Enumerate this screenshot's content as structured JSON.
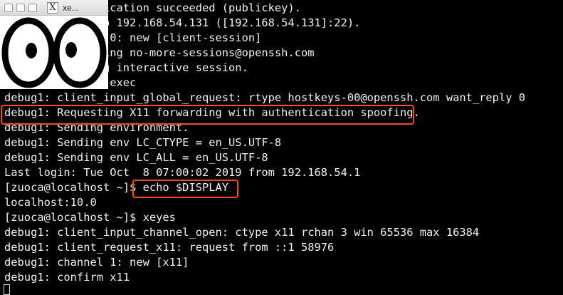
{
  "terminal": {
    "lines": [
      "debug1: Authentication succeeded (publickey).",
      "Authenticated to 192.168.54.131 ([192.168.54.131]:22).",
      "debug1: channel 0: new [client-session]",
      "debug1: Requesting no-more-sessions@openssh.com",
      "debug1: Entering interactive session.",
      "debug1: pledge: exec",
      "debug1: client_input_global_request: rtype hostkeys-00@openssh.com want_reply 0",
      "debug1: Requesting X11 forwarding with authentication spoofing.",
      "debug1: Sending environment.",
      "debug1: Sending env LC_CTYPE = en_US.UTF-8",
      "debug1: Sending env LC_ALL = en_US.UTF-8",
      "Last login: Tue Oct  8 07:00:02 2019 from 192.168.54.1",
      "[zuoca@localhost ~]$ echo $DISPLAY",
      "localhost:10.0",
      "[zuoca@localhost ~]$ xeyes",
      "debug1: client_input_channel_open: ctype x11 rchan 3 win 65536 max 16384",
      "debug1: client_request_x11: request from ::1 58976",
      "debug1: channel 1: new [x11]",
      "debug1: confirm x11"
    ],
    "highlight_color": "#ff4a1c"
  },
  "xeyes_window": {
    "title": "xe...",
    "app_icon_glyph": "X",
    "buttons": [
      "close",
      "minimize",
      "maximize"
    ]
  }
}
